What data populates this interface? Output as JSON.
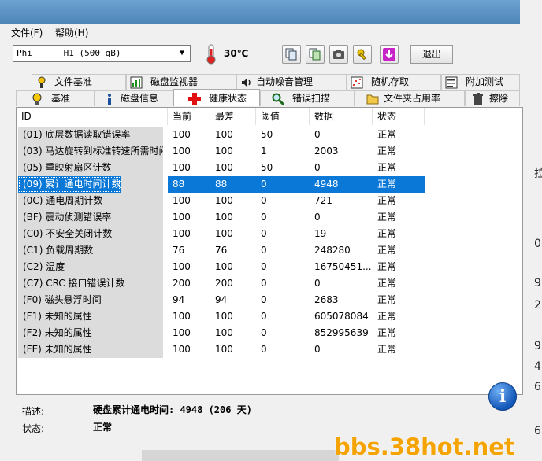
{
  "menu": {
    "file": "文件(F)",
    "help": "帮助(H)"
  },
  "toolbar": {
    "drive": "Phi      H1 (500 gB)",
    "temperature": "30℃",
    "exit_label": "退出"
  },
  "tabs_top": [
    "文件基准",
    "磁盘监视器",
    "自动噪音管理",
    "随机存取",
    "附加测试"
  ],
  "tabs_bottom": [
    "基准",
    "磁盘信息",
    "健康状态",
    "错误扫描",
    "文件夹占用率",
    "擦除"
  ],
  "table": {
    "headers": [
      "ID",
      "当前",
      "最差",
      "阈值",
      "数据",
      "状态"
    ],
    "rows": [
      [
        "(01) 底层数据读取错误率",
        "100",
        "100",
        "50",
        "0",
        "正常"
      ],
      [
        "(03) 马达旋转到标准转速所需时间",
        "100",
        "100",
        "1",
        "2003",
        "正常"
      ],
      [
        "(05) 重映射扇区计数",
        "100",
        "100",
        "50",
        "0",
        "正常"
      ],
      [
        "(09) 累计通电时间计数",
        "88",
        "88",
        "0",
        "4948",
        "正常"
      ],
      [
        "(0C) 通电周期计数",
        "100",
        "100",
        "0",
        "721",
        "正常"
      ],
      [
        "(BF) 震动侦测错误率",
        "100",
        "100",
        "0",
        "0",
        "正常"
      ],
      [
        "(C0) 不安全关闭计数",
        "100",
        "100",
        "0",
        "19",
        "正常"
      ],
      [
        "(C1) 负载周期数",
        "76",
        "76",
        "0",
        "248280",
        "正常"
      ],
      [
        "(C2) 温度",
        "100",
        "100",
        "0",
        "16750451...",
        "正常"
      ],
      [
        "(C7) CRC 接口错误计数",
        "200",
        "200",
        "0",
        "0",
        "正常"
      ],
      [
        "(F0) 磁头悬浮时间",
        "94",
        "94",
        "0",
        "2683",
        "正常"
      ],
      [
        "(F1) 未知的属性",
        "100",
        "100",
        "0",
        "605078084",
        "正常"
      ],
      [
        "(F2) 未知的属性",
        "100",
        "100",
        "0",
        "852995639",
        "正常"
      ],
      [
        "(FE) 未知的属性",
        "100",
        "100",
        "0",
        "0",
        "正常"
      ]
    ],
    "selected_index": 3
  },
  "footer": {
    "desc_label": "描述:",
    "desc_value": "硬盘累计通电时间: 4948 (206 天)",
    "status_label": "状态:",
    "status_value": "正常"
  },
  "right_edge_text": [
    "拉",
    "0",
    "9",
    "2",
    "9",
    "4",
    "6",
    "6"
  ],
  "watermark": "bbs.38hot.net",
  "colors": {
    "selection": "#0a78d7",
    "watermark": "#f5a300"
  }
}
